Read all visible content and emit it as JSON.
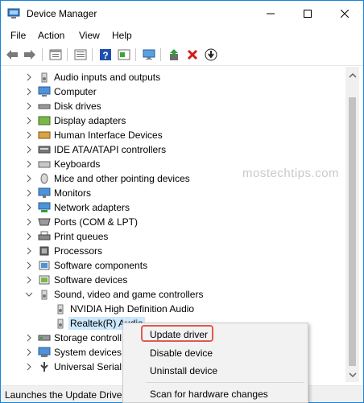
{
  "window": {
    "title": "Device Manager",
    "accent_color": "#1883d7"
  },
  "menu": [
    "File",
    "Action",
    "View",
    "Help"
  ],
  "toolbar_icons": [
    "back-arrow-icon",
    "forward-arrow-icon",
    "properties-icon",
    "list-icon",
    "help-icon",
    "console-icon",
    "monitor-icon",
    "update-driver-icon",
    "uninstall-icon",
    "download-icon"
  ],
  "tree": {
    "categories": [
      {
        "label": "Audio inputs and outputs",
        "icon": "speaker-icon"
      },
      {
        "label": "Computer",
        "icon": "computer-icon"
      },
      {
        "label": "Disk drives",
        "icon": "disk-icon"
      },
      {
        "label": "Display adapters",
        "icon": "display-adapter-icon"
      },
      {
        "label": "Human Interface Devices",
        "icon": "hid-icon"
      },
      {
        "label": "IDE ATA/ATAPI controllers",
        "icon": "ide-icon"
      },
      {
        "label": "Keyboards",
        "icon": "keyboard-icon"
      },
      {
        "label": "Mice and other pointing devices",
        "icon": "mouse-icon"
      },
      {
        "label": "Monitors",
        "icon": "monitor-icon"
      },
      {
        "label": "Network adapters",
        "icon": "network-icon"
      },
      {
        "label": "Ports (COM & LPT)",
        "icon": "port-icon"
      },
      {
        "label": "Print queues",
        "icon": "printer-icon"
      },
      {
        "label": "Processors",
        "icon": "processor-icon"
      },
      {
        "label": "Software components",
        "icon": "software-component-icon"
      },
      {
        "label": "Software devices",
        "icon": "software-device-icon"
      },
      {
        "label": "Sound, video and game controllers",
        "icon": "speaker-icon"
      }
    ],
    "children": [
      {
        "label": "NVIDIA High Definition Audio",
        "icon": "speaker-icon"
      },
      {
        "label": "Realtek(R) Audio",
        "icon": "speaker-icon"
      }
    ],
    "after": [
      {
        "label": "Storage controll",
        "icon": "storage-icon"
      },
      {
        "label": "System devices",
        "icon": "system-icon"
      },
      {
        "label": "Universal Serial E",
        "icon": "usb-icon"
      }
    ]
  },
  "watermark": "mostechtips.com",
  "context_menu": {
    "items": [
      "Update driver",
      "Disable device",
      "Uninstall device"
    ],
    "scan": "Scan for hardware changes",
    "highlight_color": "#e05a4e"
  },
  "status": "Launches the Update Driver"
}
